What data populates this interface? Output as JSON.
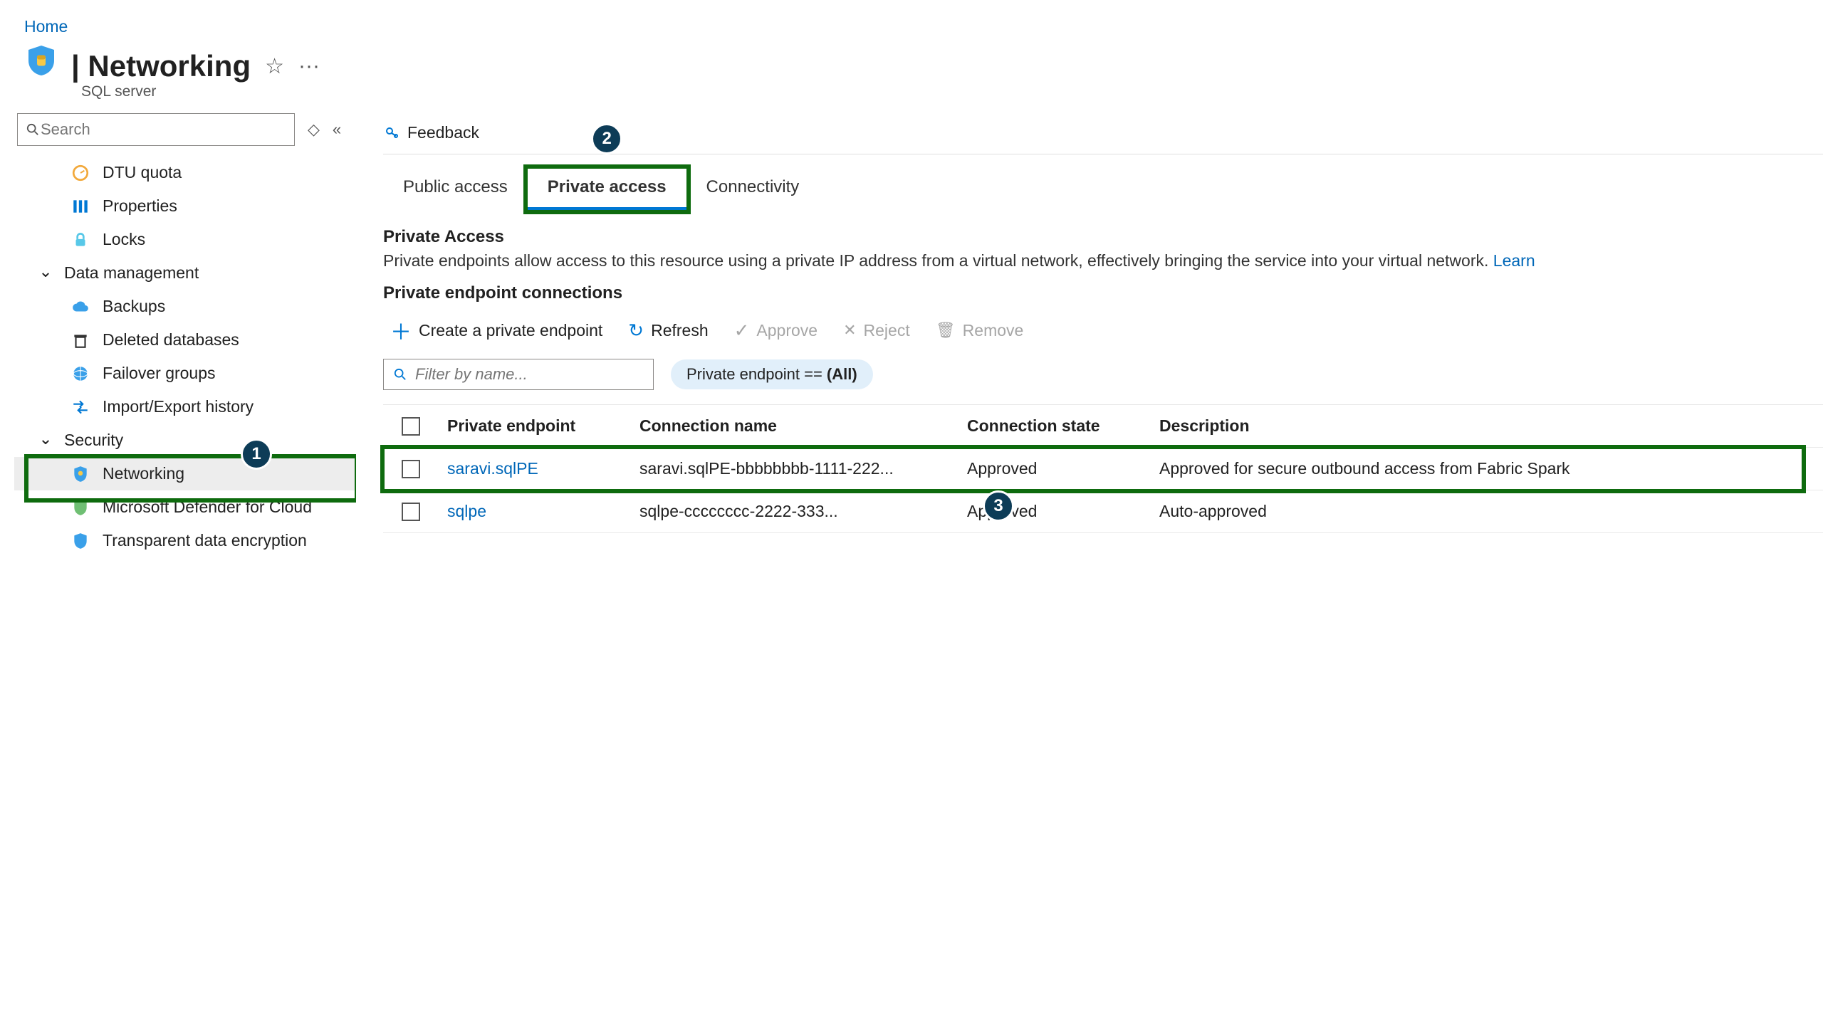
{
  "breadcrumb": {
    "home": "Home"
  },
  "header": {
    "title": "| Networking",
    "subtitle": "SQL server"
  },
  "search": {
    "placeholder": "Search"
  },
  "sidebar": {
    "items": [
      {
        "label": "DTU quota"
      },
      {
        "label": "Properties"
      },
      {
        "label": "Locks"
      }
    ],
    "section1": "Data management",
    "data_mgmt": [
      {
        "label": "Backups"
      },
      {
        "label": "Deleted databases"
      },
      {
        "label": "Failover groups"
      },
      {
        "label": "Import/Export history"
      }
    ],
    "section2": "Security",
    "security": [
      {
        "label": "Networking"
      },
      {
        "label": "Microsoft Defender for Cloud"
      },
      {
        "label": "Transparent data encryption"
      }
    ]
  },
  "cmdbar": {
    "feedback": "Feedback"
  },
  "tabs": {
    "public": "Public access",
    "private": "Private access",
    "conn": "Connectivity"
  },
  "section": {
    "title": "Private Access",
    "desc": "Private endpoints allow access to this resource using a private IP address from a virtual network, effectively bringing the service into your virtual network. ",
    "learn": "Learn",
    "subtitle": "Private endpoint connections"
  },
  "toolbar": {
    "create": "Create a private endpoint",
    "refresh": "Refresh",
    "approve": "Approve",
    "reject": "Reject",
    "remove": "Remove"
  },
  "filter": {
    "placeholder": "Filter by name...",
    "pill_prefix": "Private endpoint == ",
    "pill_bold": "(All)"
  },
  "table": {
    "headers": {
      "pe": "Private endpoint",
      "conn": "Connection name",
      "state": "Connection state",
      "desc": "Description"
    },
    "rows": [
      {
        "pe": "saravi.sqlPE",
        "conn": "saravi.sqlPE-bbbbbbbb-1111-222...",
        "state": "Approved",
        "desc": "Approved for secure outbound access from Fabric Spark"
      },
      {
        "pe": "sqlpe",
        "conn": "sqlpe-cccccccc-2222-333...",
        "state": "Approved",
        "desc": "Auto-approved"
      }
    ]
  },
  "callouts": {
    "one": "1",
    "two": "2",
    "three": "3"
  },
  "icons": {
    "plus": "＋",
    "refresh": "↻",
    "check": "✓",
    "x": "✕",
    "trash": "🗑",
    "star": "☆",
    "dots": "···",
    "search": "🔍",
    "chevron_down": "⌄",
    "collapse": "«",
    "expand": "◇"
  }
}
